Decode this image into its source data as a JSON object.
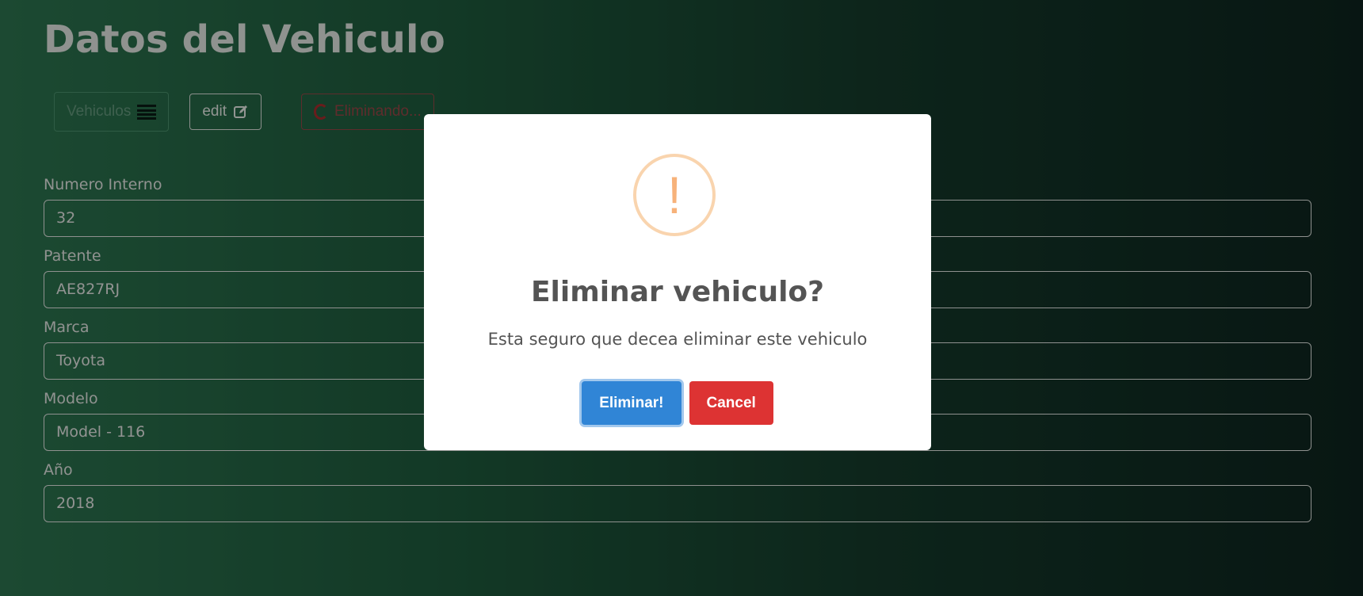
{
  "header": {
    "title": "Datos del Vehiculo"
  },
  "toolbar": {
    "vehiculos_label": "Vehiculos",
    "edit_label": "edit",
    "delete_label": "Eliminando..."
  },
  "form": {
    "fields": [
      {
        "label": "Numero Interno",
        "value": "32"
      },
      {
        "label": "Patente",
        "value": "AE827RJ"
      },
      {
        "label": "Marca",
        "value": "Toyota"
      },
      {
        "label": "Modelo",
        "value": "Model - 116"
      },
      {
        "label": "Año",
        "value": "2018"
      }
    ]
  },
  "modal": {
    "icon": "exclamation-icon",
    "icon_glyph": "!",
    "title": "Eliminar vehiculo?",
    "text": "Esta seguro que decea eliminar este vehiculo",
    "confirm_label": "Eliminar!",
    "cancel_label": "Cancel"
  },
  "colors": {
    "confirm": "#3085d6",
    "cancel": "#dd3333",
    "warning": "#f8bb86"
  }
}
